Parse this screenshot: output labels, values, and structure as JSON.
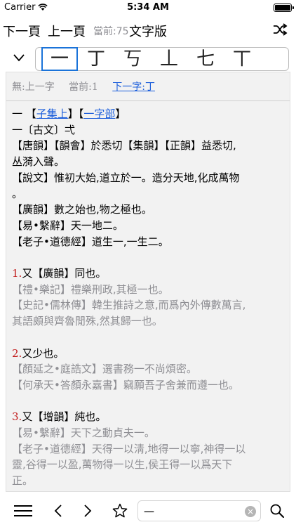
{
  "status": {
    "carrier": "Carrier",
    "time": "5:34 AM",
    "battery_percent": 100
  },
  "nav": {
    "next_label": "下一頁",
    "prev_label": "上一頁",
    "current_label": "當前:75",
    "title": "文字版",
    "shuffle_icon": "shuffle-icon"
  },
  "picker": {
    "selected_index": 0,
    "chars": [
      "一",
      "丁",
      "丂",
      "丄",
      "七",
      "丅"
    ]
  },
  "article": {
    "prev_char": "無:上一字",
    "current": "當前:1",
    "next_char": "下一字:丁",
    "lines": [
      {
        "parts": [
          {
            "text": "一 【"
          },
          {
            "text": "子集上",
            "link": true
          },
          {
            "text": "】【"
          },
          {
            "text": "一字部",
            "link": true
          },
          {
            "text": "】"
          }
        ]
      },
      {
        "parts": [
          {
            "text": "一〔古文〕弌"
          }
        ]
      },
      {
        "parts": [
          {
            "text": "【唐韻】【韻會】於悉切【集韻】【正韻】益悉切,"
          }
        ]
      },
      {
        "parts": [
          {
            "text": "丛漪入聲。"
          }
        ]
      },
      {
        "parts": [
          {
            "text": "【說文】惟初大始,道立於一。造分天地,化成萬物"
          }
        ]
      },
      {
        "parts": [
          {
            "text": "。"
          }
        ]
      },
      {
        "parts": [
          {
            "text": "【廣韻】數之始也,物之極也。"
          }
        ]
      },
      {
        "parts": [
          {
            "text": "【易•繫辭】天一地二。"
          }
        ]
      },
      {
        "parts": [
          {
            "text": "【老子•道德經】道生一,一生二。"
          }
        ]
      },
      {
        "blank": true
      },
      {
        "parts": [
          {
            "text": "1.",
            "num": true
          },
          {
            "text": "又【廣韻】同也。"
          }
        ]
      },
      {
        "gray": true,
        "parts": [
          {
            "text": "【禮•樂記】禮樂刑政,其極一也。"
          }
        ]
      },
      {
        "gray": true,
        "parts": [
          {
            "text": "【史記•儒林傳】韓生推詩之意,而爲內外傳數萬言,"
          }
        ]
      },
      {
        "gray": true,
        "parts": [
          {
            "text": "其語頗與齊魯閒殊,然其歸一也。"
          }
        ]
      },
      {
        "blank": true
      },
      {
        "parts": [
          {
            "text": "2.",
            "num": true
          },
          {
            "text": "又少也。"
          }
        ]
      },
      {
        "gray": true,
        "parts": [
          {
            "text": "【顏延之•庭誥文】選書務一不尚煩密。"
          }
        ]
      },
      {
        "gray": true,
        "parts": [
          {
            "text": "【何承天•答顏永嘉書】竊願吾子舍兼而遵一也。"
          }
        ]
      },
      {
        "blank": true
      },
      {
        "parts": [
          {
            "text": "3.",
            "num": true
          },
          {
            "text": "又【增韻】純也。"
          }
        ]
      },
      {
        "gray": true,
        "parts": [
          {
            "text": "【易•繫辭】天下之動貞夫一。"
          }
        ]
      },
      {
        "gray": true,
        "parts": [
          {
            "text": "【老子•道德經】天得一以淸,地得一以寧,神得一以"
          }
        ]
      },
      {
        "gray": true,
        "parts": [
          {
            "text": "靈,谷得一以盈,萬物得一以生,侯王得一以爲天下"
          }
        ]
      },
      {
        "gray": true,
        "parts": [
          {
            "text": "正。"
          }
        ]
      }
    ]
  },
  "toolbar": {
    "search_value": "一",
    "clear_glyph": "×",
    "icons": [
      "menu-icon",
      "back-arrow-icon",
      "forward-arrow-icon",
      "star-icon",
      "search-icon"
    ]
  }
}
